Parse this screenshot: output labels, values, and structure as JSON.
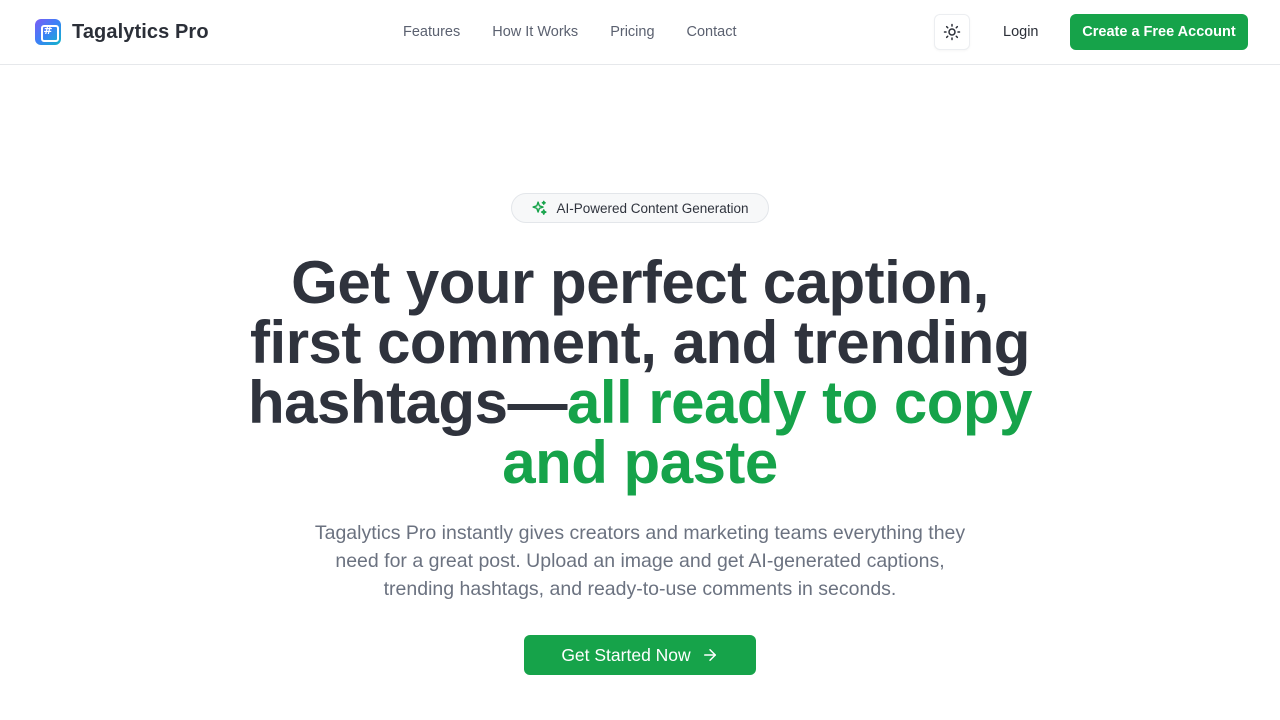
{
  "brand": {
    "name": "Tagalytics Pro",
    "logo_icon": "hashtag-chat-logo"
  },
  "nav": {
    "links": [
      "Features",
      "How It Works",
      "Pricing",
      "Contact"
    ],
    "theme_toggle_icon": "sun-icon",
    "login_label": "Login",
    "signup_label": "Create a Free Account"
  },
  "hero": {
    "badge": {
      "icon": "sparkles-icon",
      "text": "AI-Powered Content Generation"
    },
    "headline_main": "Get your perfect caption, first comment, and trending hashtags—",
    "headline_accent": "all ready to copy and paste",
    "subtext": "Tagalytics Pro instantly gives creators and marketing teams everything they need for a great post. Upload an image and get AI-generated captions, trending hashtags, and ready-to-use comments in seconds.",
    "cta_label": "Get Started Now",
    "cta_icon": "arrow-right-icon"
  },
  "colors": {
    "accent": "#16a34a",
    "heading": "#2f333d",
    "muted": "#6b7280",
    "border": "#e6e8eb"
  }
}
